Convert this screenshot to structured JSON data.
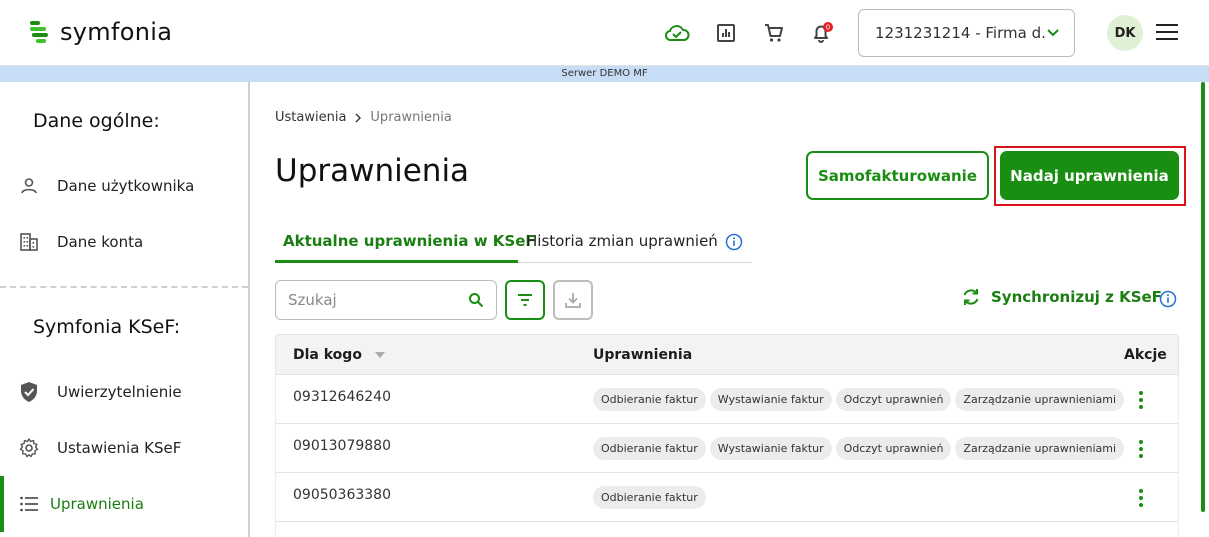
{
  "header": {
    "logo_text": "symfonia",
    "company_select": "1231231214 - Firma d...",
    "avatar_initials": "DK",
    "notification_count": "0"
  },
  "server_bar": "Serwer DEMO MF",
  "sidebar": {
    "section1_title": "Dane ogólne:",
    "section1_items": [
      {
        "label": "Dane użytkownika",
        "icon": "person-icon"
      },
      {
        "label": "Dane konta",
        "icon": "building-icon"
      }
    ],
    "section2_title": "Symfonia KSeF:",
    "section2_items": [
      {
        "label": "Uwierzytelnienie",
        "icon": "shield-icon"
      },
      {
        "label": "Ustawienia KSeF",
        "icon": "gear-icon"
      },
      {
        "label": "Uprawnienia",
        "icon": "list-icon",
        "active": true
      }
    ]
  },
  "breadcrumb": {
    "root": "Ustawienia",
    "current": "Uprawnienia"
  },
  "page_title": "Uprawnienia",
  "buttons": {
    "secondary": "Samofakturowanie",
    "primary": "Nadaj uprawnienia"
  },
  "tabs": [
    {
      "label": "Aktualne uprawnienia w KSeF",
      "active": true
    },
    {
      "label": "Historia zmian uprawnień",
      "active": false
    }
  ],
  "toolbar": {
    "search_placeholder": "Szukaj",
    "sync_label": "Synchronizuj z KSeF"
  },
  "table": {
    "columns": [
      "Dla kogo",
      "Uprawnienia",
      "Akcje"
    ],
    "rows": [
      {
        "id": "09312646240",
        "permissions": [
          "Odbieranie faktur",
          "Wystawianie faktur",
          "Odczyt uprawnień",
          "Zarządzanie uprawnieniami"
        ]
      },
      {
        "id": "09013079880",
        "permissions": [
          "Odbieranie faktur",
          "Wystawianie faktur",
          "Odczyt uprawnień",
          "Zarządzanie uprawnieniami"
        ]
      },
      {
        "id": "09050363380",
        "permissions": [
          "Odbieranie faktur"
        ]
      }
    ]
  },
  "colors": {
    "accent": "#1a8e12",
    "highlight": "#d8141a",
    "server_bar": "#c7dcf5"
  }
}
